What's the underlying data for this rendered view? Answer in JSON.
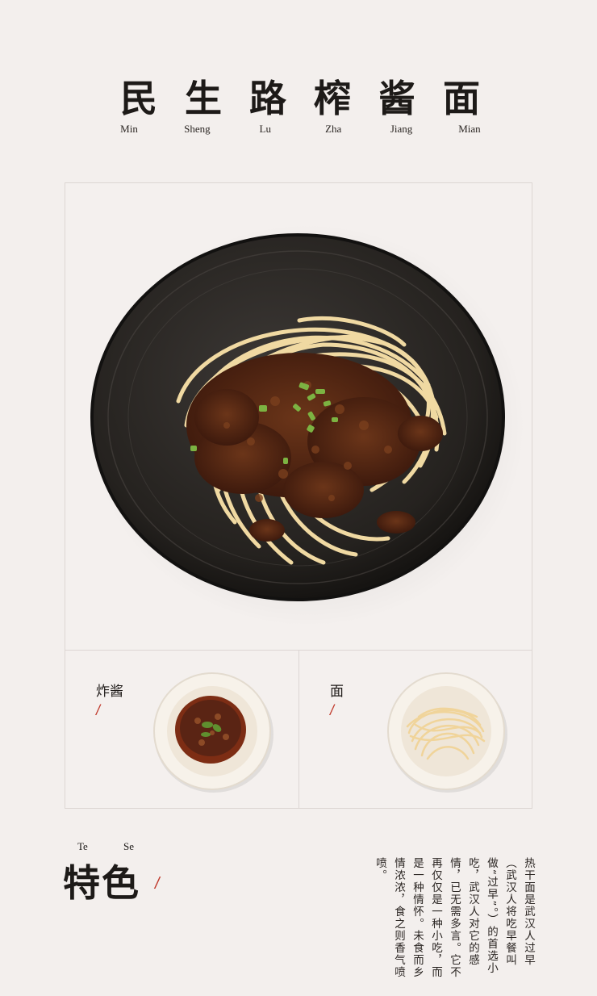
{
  "title": {
    "chars": [
      "民",
      "生",
      "路",
      "榨",
      "酱",
      "面"
    ],
    "pinyin": [
      "Min",
      "Sheng",
      "Lu",
      "Zha",
      "Jiang",
      "Mian"
    ]
  },
  "ingredients": {
    "left_label": "炸酱",
    "right_label": "面",
    "slash": "/"
  },
  "feature": {
    "pinyin": [
      "Te",
      "Se"
    ],
    "title": "特色",
    "slash": "/",
    "body": "热干面是武汉人过早（武汉人将吃早餐叫做“过早”。）的首选小吃，武汉人对它的感情，已无需多言。它不再仅仅是一种小吃，而是一种情怀。未食而乡情浓浓，食之则香气喷喷。"
  },
  "colors": {
    "background": "#f3efed",
    "accent": "#c0392b",
    "bowl": "#2c2927",
    "noodle": "#f1dca6",
    "sauce": "#5a2a18",
    "scallion": "#7cb342"
  }
}
